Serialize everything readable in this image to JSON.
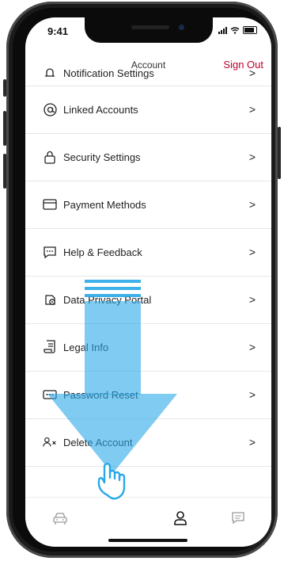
{
  "status_bar": {
    "time": "9:41"
  },
  "header": {
    "title": "Account",
    "sign_out": "Sign Out"
  },
  "menu": [
    {
      "label": "Notification Settings",
      "icon": "bell-icon"
    },
    {
      "label": "Linked Accounts",
      "icon": "at-icon"
    },
    {
      "label": "Security Settings",
      "icon": "lock-icon"
    },
    {
      "label": "Payment Methods",
      "icon": "card-icon"
    },
    {
      "label": "Help & Feedback",
      "icon": "chat-icon"
    },
    {
      "label": "Data Privacy Portal",
      "icon": "privacy-icon"
    },
    {
      "label": "Legal Info",
      "icon": "document-icon"
    },
    {
      "label": "Password Reset",
      "icon": "password-icon"
    },
    {
      "label": "Delete Account",
      "icon": "delete-user-icon"
    }
  ],
  "chevron": ">",
  "tabbar": [
    {
      "name": "car-icon",
      "active": false
    },
    {
      "name": "user-icon",
      "active": true
    },
    {
      "name": "message-icon",
      "active": false
    }
  ],
  "colors": {
    "accent": "#c2002f",
    "overlay_blue": "#29a8e8",
    "text": "#222222"
  }
}
